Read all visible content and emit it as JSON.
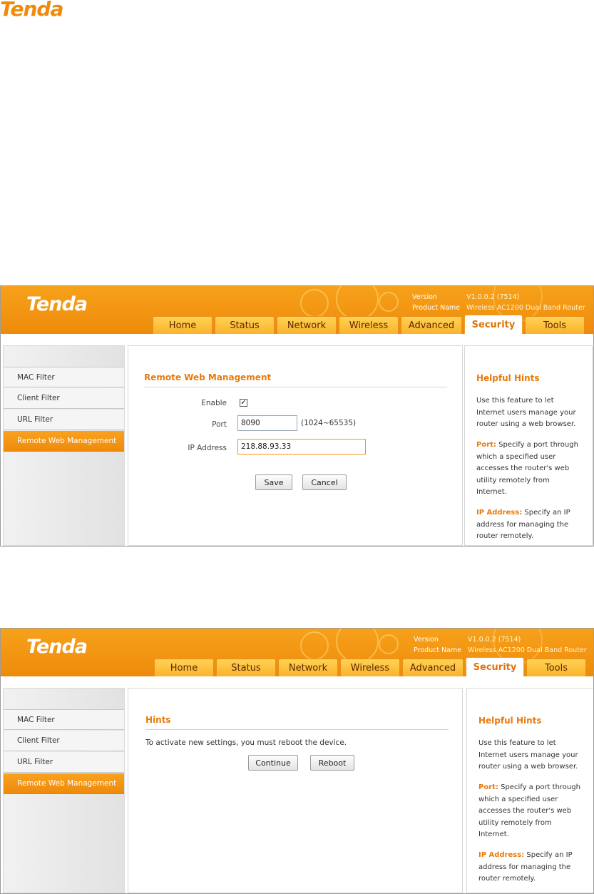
{
  "page_logo": "Tenda",
  "router": {
    "logo": "Tenda",
    "version_label": "Version",
    "version_value": "V1.0.0.2 (7514)",
    "product_label": "Product Name",
    "product_value": "Wireless AC1200 Dual Band Router",
    "tabs": [
      "Home",
      "Status",
      "Network",
      "Wireless",
      "Advanced",
      "Security",
      "Tools"
    ],
    "active_tab": "Security",
    "sidebar": [
      "MAC Filter",
      "Client Filter",
      "URL Filter",
      "Remote Web Management"
    ],
    "active_sidebar": "Remote Web Management",
    "hints": {
      "title": "Helpful Hints",
      "intro": "Use this feature to let Internet users manage your router using a web browser.",
      "port_label": "Port:",
      "port_text": "Specify a port through which a specified user accesses the router's web utility remotely from Internet.",
      "ip_label": "IP Address:",
      "ip_text": "Specify an IP address for managing the router remotely."
    }
  },
  "screen1": {
    "title": "Remote Web Management",
    "enable_label": "Enable",
    "enable_checked": true,
    "port_label": "Port",
    "port_value": "8090",
    "port_range": "(1024~65535)",
    "ip_label": "IP Address",
    "ip_value": "218.88.93.33",
    "save": "Save",
    "cancel": "Cancel"
  },
  "screen2": {
    "title": "Hints",
    "message": "To activate new settings, you must reboot the device.",
    "continue": "Continue",
    "reboot": "Reboot"
  },
  "colors": {
    "brand_orange": "#f29512",
    "accent_text": "#e87a0c",
    "tab_yellow": "#fbb32b"
  }
}
